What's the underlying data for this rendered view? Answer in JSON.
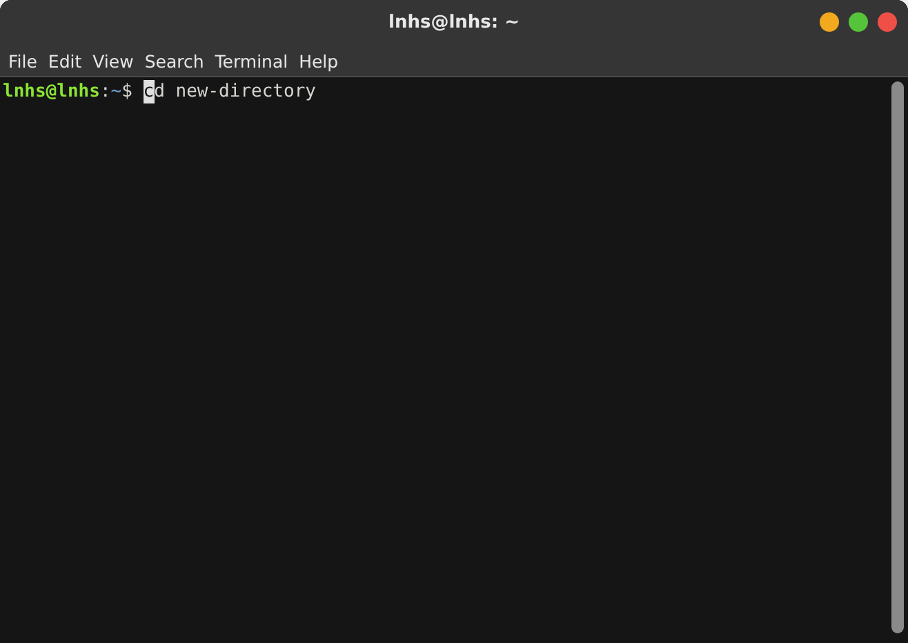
{
  "window": {
    "title": "lnhs@lnhs: ~"
  },
  "menu": [
    "File",
    "Edit",
    "View",
    "Search",
    "Terminal",
    "Help"
  ],
  "terminal": {
    "user_host": "lnhs@lnhs",
    "separator": ":",
    "path": "~",
    "prompt_symbol": "$",
    "command": "cd new-directory",
    "cursor": true
  }
}
